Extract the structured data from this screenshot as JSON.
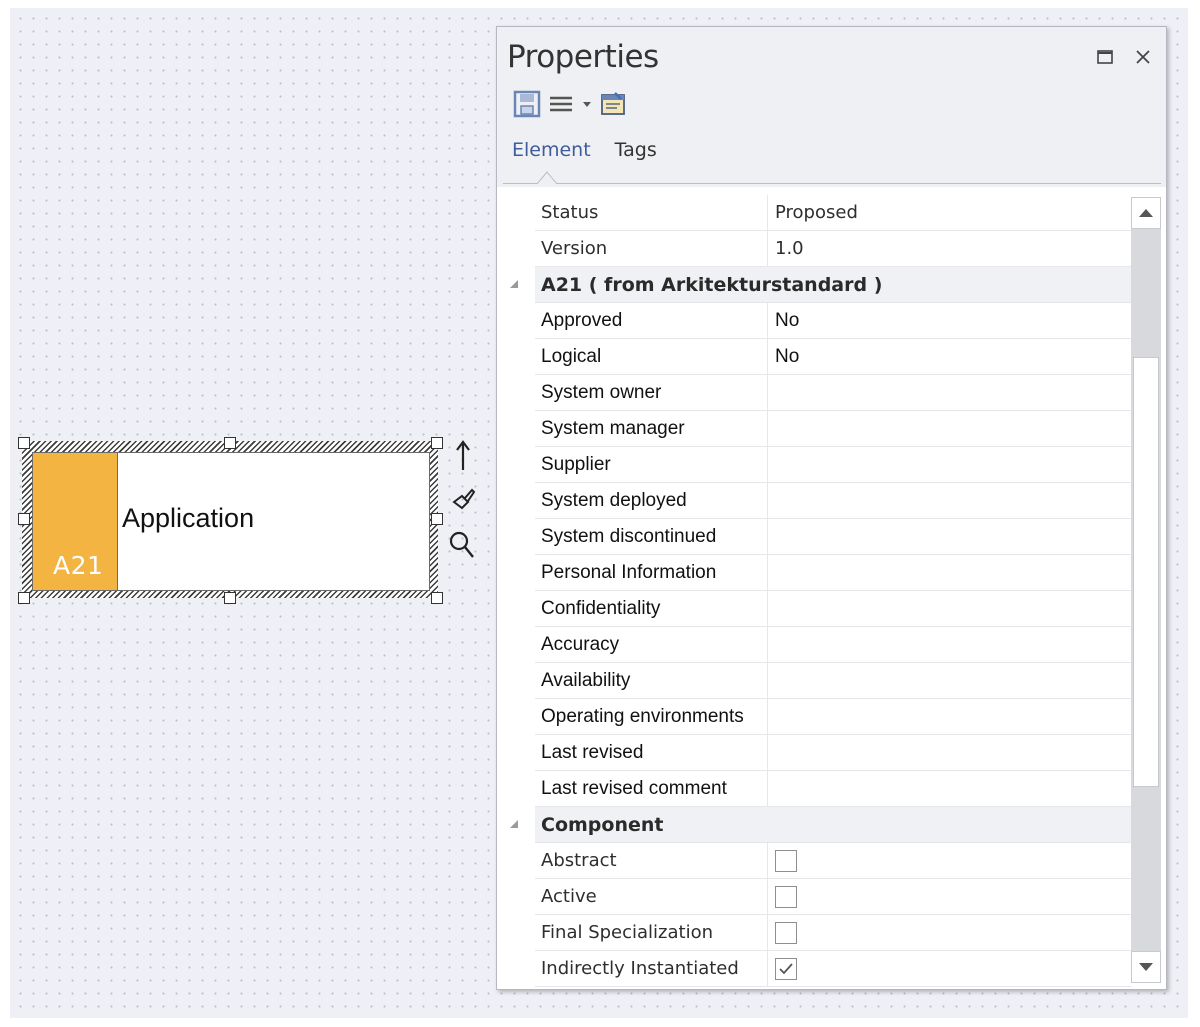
{
  "diagram": {
    "element": {
      "name": "Application",
      "code": "A21",
      "stripe_color": "#f3b441"
    },
    "side_tools": [
      "up-arrow-icon",
      "paint-brush-icon",
      "magnifier-icon"
    ]
  },
  "properties_panel": {
    "title": "Properties",
    "title_buttons": [
      "maximize-icon",
      "close-icon"
    ],
    "toolbar": [
      "save-icon",
      "menu-icon",
      "dropdown-arrow-icon",
      "properties-dialog-icon"
    ],
    "tabs": [
      {
        "label": "Element",
        "active": true
      },
      {
        "label": "Tags",
        "active": false
      }
    ],
    "rows": [
      {
        "name": "Status",
        "value": "Proposed"
      },
      {
        "name": "Version",
        "value": "1.0"
      }
    ],
    "group_a21": {
      "label": "A21  ( from Arkitekturstandard )",
      "rows": [
        {
          "name": "Approved",
          "value": "No"
        },
        {
          "name": "Logical",
          "value": "No"
        },
        {
          "name": "System owner",
          "value": ""
        },
        {
          "name": "System manager",
          "value": ""
        },
        {
          "name": "Supplier",
          "value": ""
        },
        {
          "name": "System deployed",
          "value": ""
        },
        {
          "name": "System discontinued",
          "value": ""
        },
        {
          "name": "Personal Information",
          "value": ""
        },
        {
          "name": "Confidentiality",
          "value": ""
        },
        {
          "name": "Accuracy",
          "value": ""
        },
        {
          "name": "Availability",
          "value": ""
        },
        {
          "name": "Operating environments",
          "value": ""
        },
        {
          "name": "Last revised",
          "value": ""
        },
        {
          "name": "Last revised comment",
          "value": ""
        }
      ]
    },
    "group_component": {
      "label": "Component",
      "rows": [
        {
          "name": "Abstract",
          "checked": false
        },
        {
          "name": "Active",
          "checked": false
        },
        {
          "name": "Final Specialization",
          "checked": false
        },
        {
          "name": "Indirectly Instantiated",
          "checked": true
        }
      ]
    },
    "scrollbar": {
      "up": "scroll-up-icon",
      "down": "scroll-down-icon"
    }
  }
}
